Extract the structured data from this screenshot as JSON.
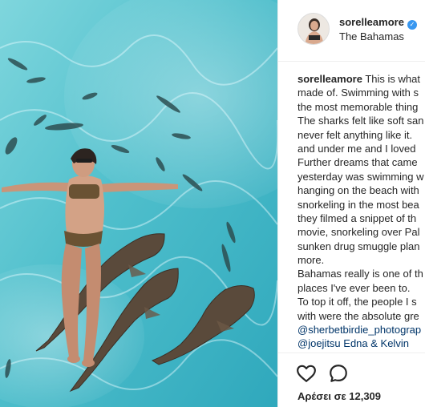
{
  "post": {
    "photo_icon": "nurse-sharks-swim-photo",
    "colors": {
      "accent": "#3897f0",
      "link": "#003569",
      "water": "#53c2cf"
    }
  },
  "header": {
    "username": "sorelleamore",
    "location": "The Bahamas",
    "verified_icon": "verified-badge-icon"
  },
  "caption": {
    "username": "sorelleamore",
    "lines": [
      "This is what",
      "made of. Swimming with s",
      "the most memorable thing",
      "The sharks felt like soft san",
      "never felt anything like it.",
      "and under me and I loved",
      "Further dreams that came",
      "yesterday was swimming w",
      "hanging on the beach with",
      "snorkeling in the most bea",
      "they filmed a snippet of th",
      "movie, snorkeling over Pal",
      "sunken drug smuggle plan",
      "more.",
      "Bahamas really is one of th",
      "places I've ever been to.",
      "To top it off, the people I s",
      "with were the absolute gre",
      "@sherbetbirdie_photograp",
      "@joejitsu Edna & Kelvin"
    ]
  },
  "actions": {
    "like_icon": "heart-icon",
    "comment_icon": "comment-icon",
    "likes_text": "Αρέσει σε 12,309"
  }
}
